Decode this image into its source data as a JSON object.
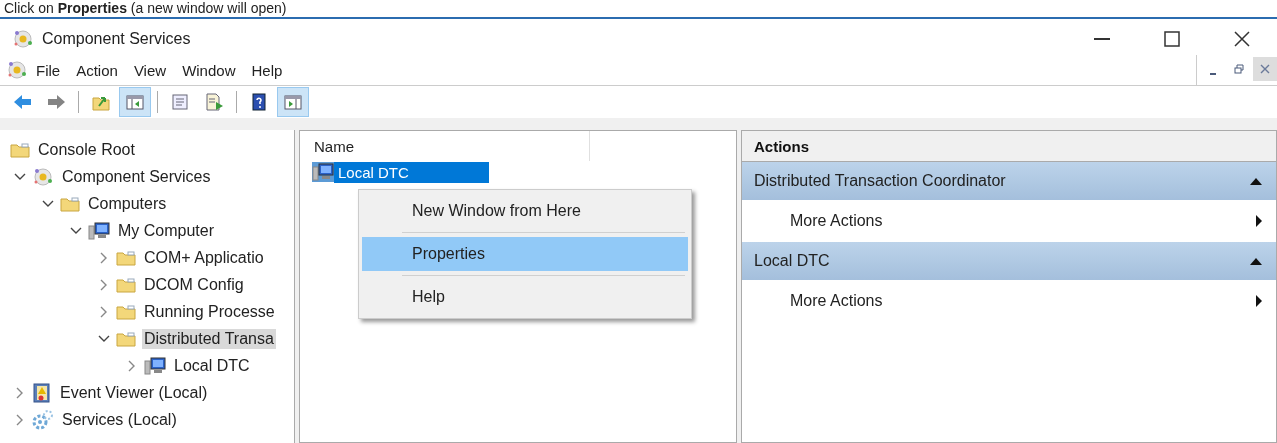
{
  "banner": {
    "text": "Click on **Properties** (a new window will open)"
  },
  "window": {
    "title": "Component Services"
  },
  "menu": [
    "File",
    "Action",
    "View",
    "Window",
    "Help"
  ],
  "toolbar": [
    {
      "kind": "back",
      "disabled": false,
      "pressed": false
    },
    {
      "kind": "forward",
      "disabled": true,
      "pressed": false
    },
    {
      "kind": "separator"
    },
    {
      "kind": "up",
      "disabled": false,
      "pressed": false
    },
    {
      "kind": "tree",
      "disabled": false,
      "pressed": true
    },
    {
      "kind": "separator"
    },
    {
      "kind": "props",
      "disabled": false,
      "pressed": false
    },
    {
      "kind": "export",
      "disabled": false,
      "pressed": false
    },
    {
      "kind": "separator"
    },
    {
      "kind": "help",
      "disabled": false,
      "pressed": false
    },
    {
      "kind": "actionpane",
      "disabled": false,
      "pressed": true
    }
  ],
  "tree": {
    "root": {
      "label": "Console Root",
      "kind": "folder",
      "children": [
        {
          "label": "Component Services",
          "kind": "component",
          "expanded": true,
          "selected": false,
          "children": [
            {
              "label": "Computers",
              "kind": "folder",
              "expanded": true,
              "selected": false,
              "children": [
                {
                  "label": "My Computer",
                  "kind": "computer",
                  "expanded": true,
                  "selected": false,
                  "children": [
                    {
                      "label": "COM+ Applicatio",
                      "kind": "folder",
                      "expanded": false,
                      "selected": false
                    },
                    {
                      "label": "DCOM Config",
                      "kind": "folder",
                      "expanded": false,
                      "selected": false
                    },
                    {
                      "label": "Running Processe",
                      "kind": "folder",
                      "expanded": false,
                      "selected": false
                    },
                    {
                      "label": "Distributed Transa",
                      "kind": "folder",
                      "expanded": true,
                      "selected": true,
                      "children": [
                        {
                          "label": "Local DTC",
                          "kind": "computer",
                          "expanded": false,
                          "selected": false
                        }
                      ]
                    }
                  ]
                }
              ]
            }
          ]
        },
        {
          "label": "Event Viewer (Local)",
          "kind": "eventlog",
          "expanded": false,
          "selected": false
        },
        {
          "label": "Services (Local)",
          "kind": "gears",
          "expanded": false,
          "selected": false
        }
      ]
    }
  },
  "list": {
    "columns": [
      "Name"
    ],
    "rows": [
      {
        "name": "Local DTC",
        "selected": true
      }
    ]
  },
  "context_menu": [
    {
      "label": "New Window from Here",
      "selected": false
    },
    {
      "label": "Properties",
      "selected": true
    },
    {
      "label": "Help",
      "selected": false
    }
  ],
  "actions": {
    "title": "Actions",
    "groups": [
      {
        "title": "Distributed Transaction Coordinator",
        "expanded": true,
        "items": [
          "More Actions"
        ]
      },
      {
        "title": "Local DTC",
        "expanded": true,
        "items": [
          "More Actions"
        ]
      }
    ]
  }
}
